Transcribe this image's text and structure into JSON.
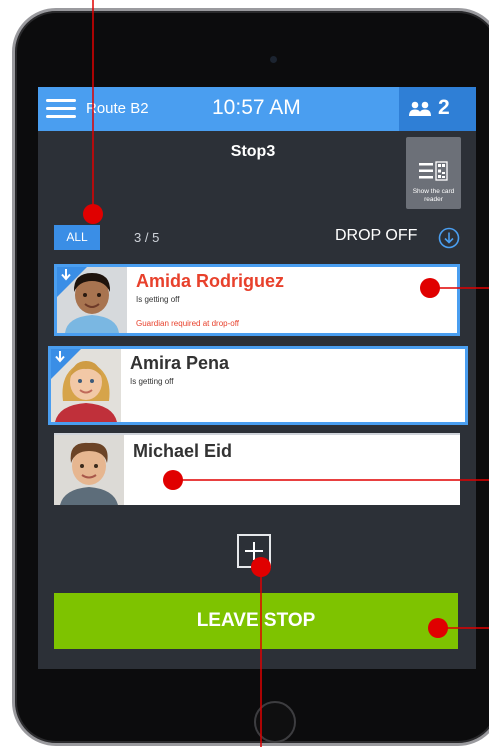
{
  "header": {
    "route": "Route B2",
    "time": "10:57 AM",
    "student_count": "2",
    "menu_icon": "hamburger-menu-icon",
    "people_icon": "people-icon"
  },
  "stop": {
    "title": "Stop3",
    "card_reader_label": "Show the card reader",
    "card_reader_icon": "qr-code-icon"
  },
  "filter": {
    "all_label": "ALL",
    "progress": "3 / 5",
    "mode_label": "DROP OFF",
    "mode_icon": "download-circle-icon"
  },
  "students": [
    {
      "name": "Amida Rodriguez",
      "status": "Is getting off",
      "note": "Guardian required at drop-off",
      "selected": true,
      "alert": true
    },
    {
      "name": "Amira Pena",
      "status": "Is getting off",
      "note": "",
      "selected": true,
      "alert": false
    },
    {
      "name": "Michael Eid",
      "status": "",
      "note": "",
      "selected": false,
      "alert": false
    }
  ],
  "actions": {
    "add_icon": "add-icon",
    "leave_label": "LEAVE STOP"
  },
  "colors": {
    "topbar": "#4a9ef0",
    "count_box": "#2f7fd6",
    "background": "#2c3037",
    "leave_button": "#7ec300",
    "alert": "#e8412c",
    "annotation": "#e00000"
  }
}
